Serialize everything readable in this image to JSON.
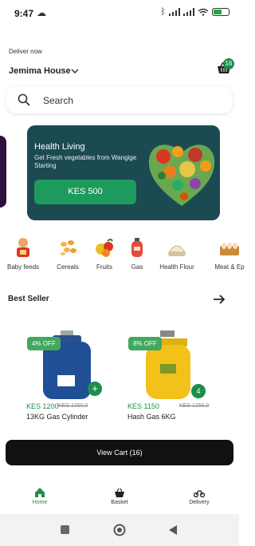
{
  "status_bar": {
    "time": "9:47"
  },
  "header": {
    "deliver_label": "Deliver now",
    "address": "Jemima House",
    "basket_count": "16"
  },
  "search": {
    "placeholder": "Search"
  },
  "promo": {
    "title": "Health Living",
    "subtitle": "Get Fresh vegetables from Wangige Starting",
    "button_label": "KES 500"
  },
  "categories": [
    {
      "label": "Baby feeds",
      "icon": "baby-icon"
    },
    {
      "label": "Cereals",
      "icon": "cereals-icon"
    },
    {
      "label": "Fruits",
      "icon": "fruits-icon"
    },
    {
      "label": "Gas",
      "icon": "gas-cylinder-icon"
    },
    {
      "label": "Health Flour",
      "icon": "flour-icon"
    },
    {
      "label": "Meat & Ep",
      "icon": "eggs-icon"
    }
  ],
  "best_seller": {
    "title": "Best Seller",
    "products": [
      {
        "discount": "4% OFF",
        "price": "KES 1200",
        "old_price": "KES 1250.0",
        "name": "13KG Gas Cylinder",
        "add_label": "+"
      },
      {
        "discount": "8% OFF",
        "price": "KES 1150",
        "old_price": "KES 1250.0",
        "name": "Hash Gas 6KG",
        "qty": "4"
      }
    ]
  },
  "cart": {
    "label": "View Cart (16)"
  },
  "bottom_nav": [
    {
      "label": "Home",
      "active": true
    },
    {
      "label": "Basket",
      "active": false
    },
    {
      "label": "Delivery",
      "active": false
    }
  ],
  "colors": {
    "brand": "#1e8e4e",
    "promo_bg": "#1c4a52",
    "cart_bar": "#111111"
  }
}
